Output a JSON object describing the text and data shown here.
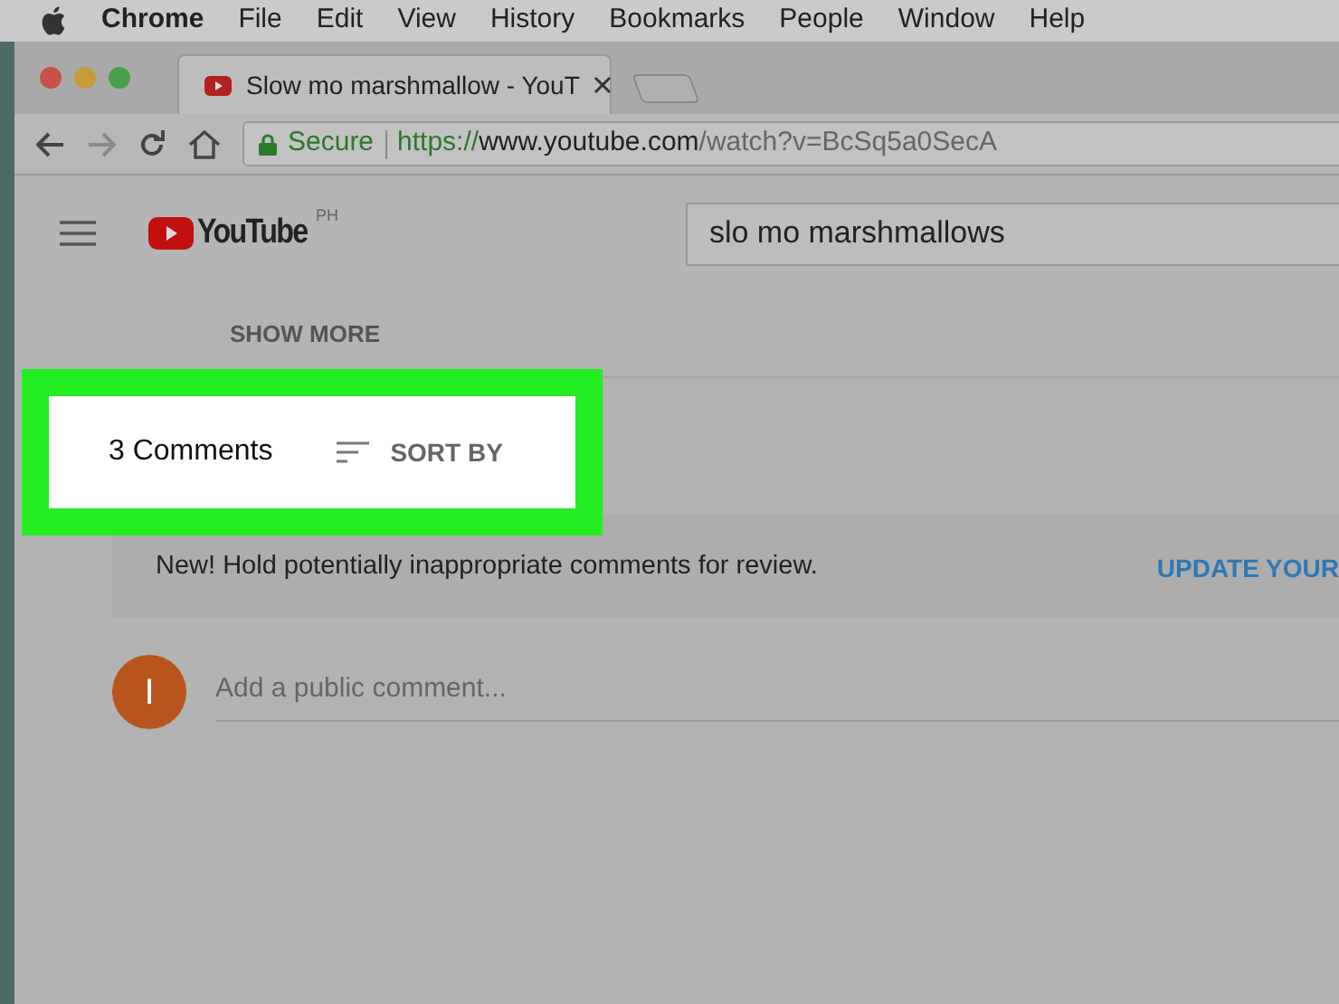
{
  "menu_bar": {
    "app": "Chrome",
    "items": [
      "File",
      "Edit",
      "View",
      "History",
      "Bookmarks",
      "People",
      "Window",
      "Help"
    ]
  },
  "tab": {
    "title": "Slow mo marshmallow - YouT"
  },
  "address_bar": {
    "security": "Secure",
    "scheme": "https://",
    "host": "www.youtube.com",
    "path": "/watch?v=BcSq5a0SecA"
  },
  "header": {
    "logo": "YouTube",
    "region": "PH",
    "search": "slo mo marshmallows"
  },
  "show_more": "SHOW MORE",
  "comments": {
    "count": "3 Comments",
    "sort": "SORT BY"
  },
  "notice": {
    "text": "New! Hold potentially inappropriate comments for review.",
    "action": "UPDATE YOUR"
  },
  "comment_box": {
    "avatar": "I",
    "placeholder": "Add a public comment..."
  }
}
